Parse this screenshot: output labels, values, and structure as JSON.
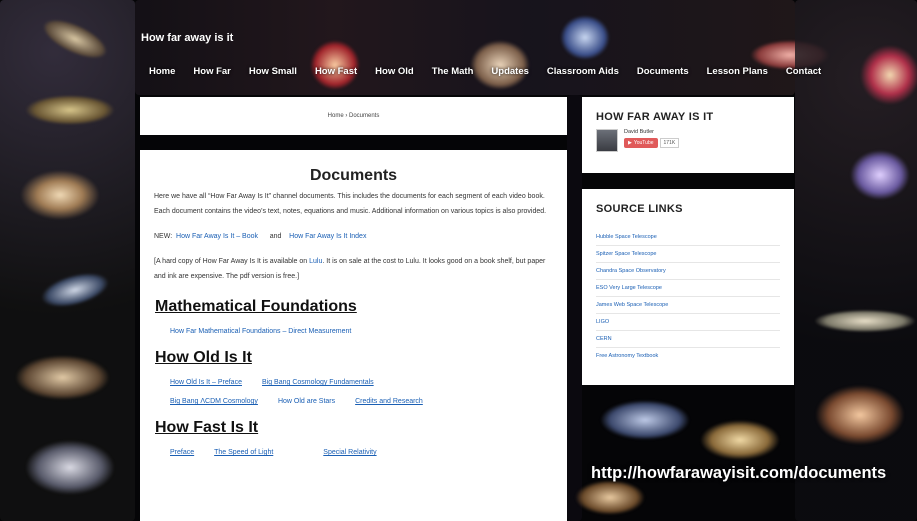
{
  "site": {
    "title": "How far away is it"
  },
  "nav": {
    "items": [
      "Home",
      "How Far",
      "How Small",
      "How Fast",
      "How Old",
      "The Math",
      "Updates",
      "Classroom Aids",
      "Documents",
      "Lesson Plans",
      "Contact"
    ]
  },
  "breadcrumb": "Home › Documents",
  "main": {
    "title": "Documents",
    "intro": "Here we have all “How Far Away Is It” channel documents. This includes the documents for each segment of each video book. Each document contains the video’s text, notes, equations and music. Additional information on various topics is also provided.",
    "new_label": "NEW:",
    "new_link1": "How Far Away Is It – Book",
    "new_and": "and",
    "new_link2": "How Far Away Is It Index",
    "note_before": "[A hard copy of How Far Away Is It is available on ",
    "note_link": "Lulu",
    "note_after": ". It is on sale at the cost to Lulu. It looks good on a book shelf, but paper and ink are expensive. The pdf version is free.]",
    "sections": [
      {
        "heading": "Mathematical Foundations",
        "links": [
          "How Far Mathematical Foundations – Direct Measurement"
        ]
      },
      {
        "heading": "How Old Is It",
        "links": [
          "How Old Is It – Preface",
          "Big Bang Cosmology Fundamentals"
        ],
        "links2": [
          "Big Bang ΛCDM Cosmology",
          "How Old are Stars",
          "Credits and Research"
        ]
      },
      {
        "heading": "How Fast Is It",
        "links": [
          "Preface",
          "The Speed of Light",
          "Special Relativity"
        ]
      }
    ]
  },
  "sidebar": {
    "channel_heading": "HOW FAR AWAY IS IT",
    "author": "David Butler",
    "youtube_label": "YouTube",
    "subscribers": "171K",
    "source_heading": "SOURCE LINKS",
    "sources": [
      "Hubble Space Telescope",
      "Spitzer Space Telescope",
      "Chandra Space Observatory",
      "ESO Very Large Telescope",
      "James Web Space Telescope",
      "LIGO",
      "CERN",
      "Free Astronomy Textbook"
    ]
  },
  "caption": "http://howfarawayisit.com/documents",
  "colors": {
    "link": "#1a5fb4",
    "background": "#050507",
    "youtube": "#e05a5a"
  }
}
